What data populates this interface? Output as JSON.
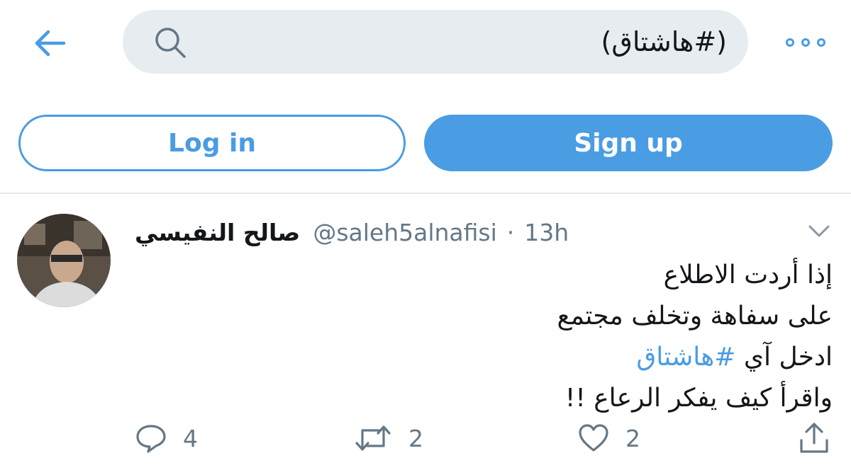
{
  "search": {
    "query": "(#هاشتاق)"
  },
  "auth": {
    "login_label": "Log in",
    "signup_label": "Sign up"
  },
  "tweet": {
    "display_name": "صالح النفيسي",
    "handle": "@saleh5alnafisi",
    "separator": "·",
    "time": "13h",
    "lines": [
      "إذا أردت الاطلاع",
      "على سفاهة وتخلف مجتمع",
      "ادخل آي ",
      "واقرأ كيف يفكر الرعاع !!"
    ],
    "hashtag": "#هاشتاق",
    "reply_count": "4",
    "retweet_count": "2",
    "like_count": "2"
  },
  "icons": {
    "back": "arrow-left-icon",
    "search": "search-icon",
    "more": "more-icon",
    "caret": "chevron-down-icon",
    "reply": "reply-icon",
    "retweet": "retweet-icon",
    "like": "heart-icon",
    "share": "share-icon"
  },
  "colors": {
    "accent": "#4a9ce3",
    "muted": "#657786",
    "search_bg": "#e6ecf0"
  }
}
